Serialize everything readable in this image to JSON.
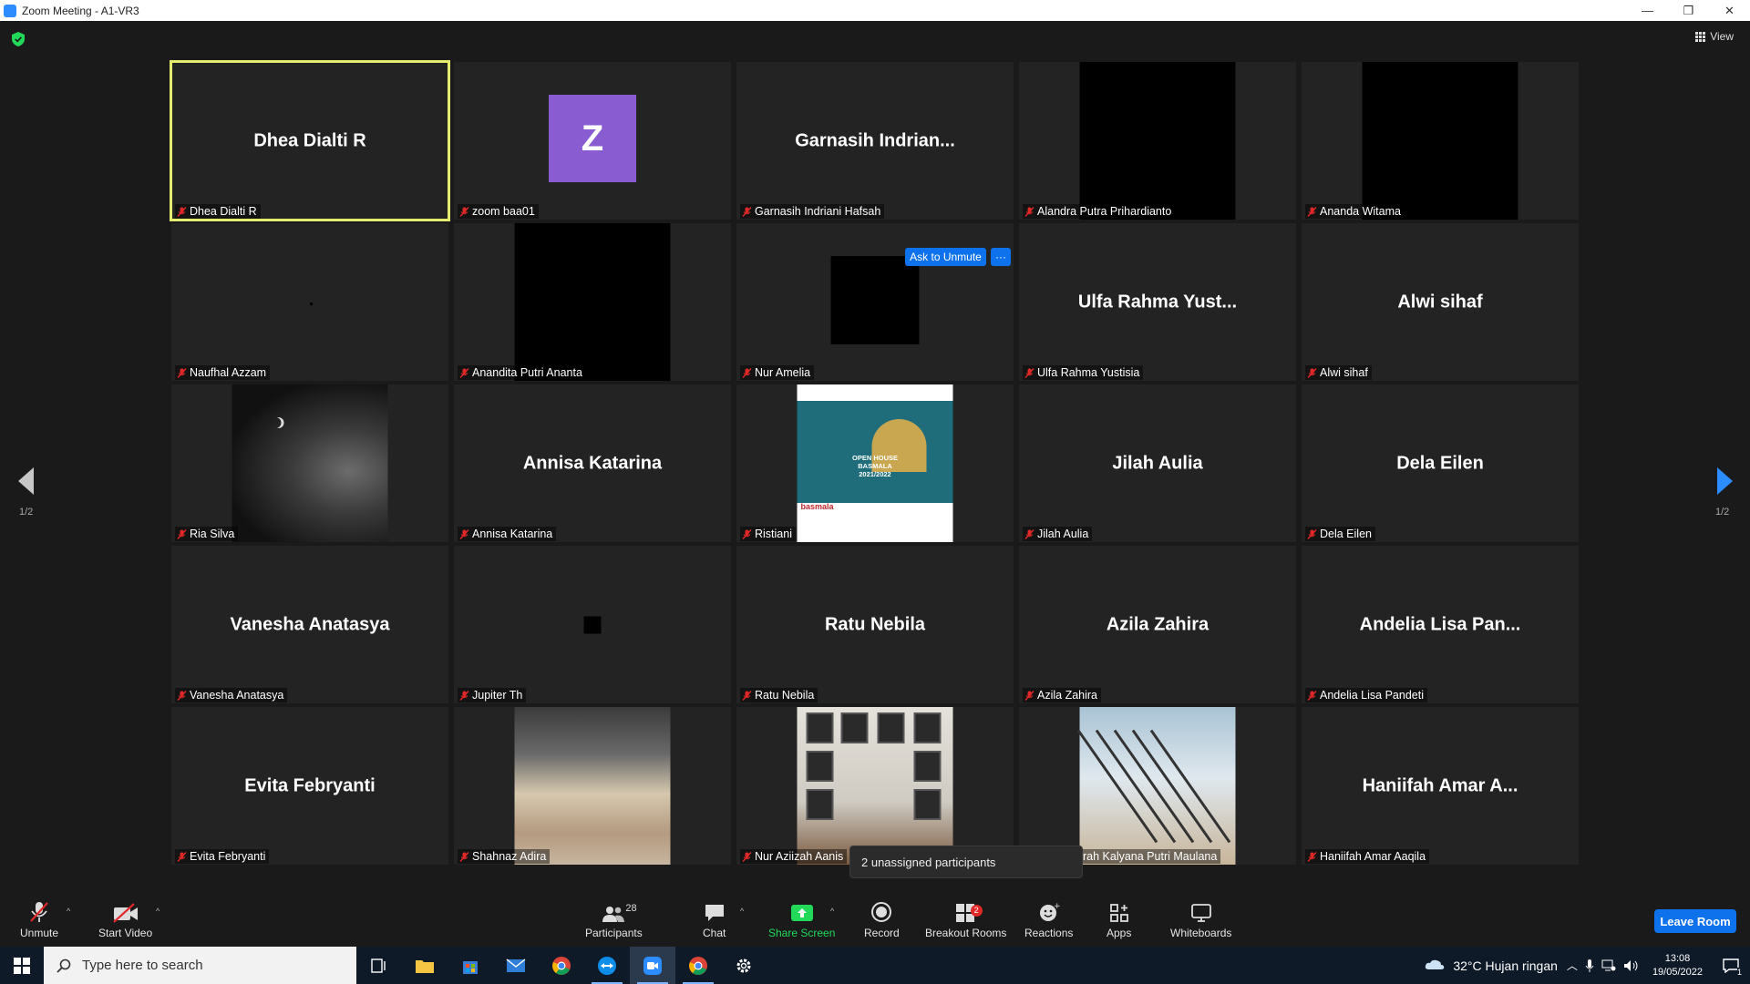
{
  "window": {
    "title": "Zoom Meeting - A1-VR3",
    "minimize_glyph": "—",
    "restore_glyph": "❐",
    "close_glyph": "✕"
  },
  "top": {
    "view_label": "View"
  },
  "tiles": [
    {
      "big": "Dhea Dialti R",
      "label": "Dhea Dialti R",
      "active": true
    },
    {
      "big": "",
      "label": "zoom baa01",
      "avatar_letter": "Z"
    },
    {
      "big": "Garnasih  Indrian...",
      "label": "Garnasih Indriani Hafsah"
    },
    {
      "big": "",
      "label": "Alandra Putra Prihardianto"
    },
    {
      "big": "",
      "label": "Ananda Witama"
    },
    {
      "big": "",
      "label": "Naufhal Azzam"
    },
    {
      "big": "",
      "label": "Anandita Putri Ananta"
    },
    {
      "big": "",
      "label": "Nur Amelia"
    },
    {
      "big": "Ulfa Rahma Yust...",
      "label": "Ulfa Rahma Yustisia"
    },
    {
      "big": "Alwi sihaf",
      "label": "Alwi sihaf"
    },
    {
      "big": "",
      "label": "Ria Silva"
    },
    {
      "big": "Annisa Katarina",
      "label": "Annisa Katarina"
    },
    {
      "big": "",
      "label": "Ristiani",
      "poster_text": "OPEN HOUSE\nBASMALA\n2021/2022",
      "poster_logo": "basmala"
    },
    {
      "big": "Jilah Aulia",
      "label": "Jilah Aulia"
    },
    {
      "big": "Dela Eilen",
      "label": "Dela Eilen"
    },
    {
      "big": "Vanesha Anatasya",
      "label": "Vanesha Anatasya"
    },
    {
      "big": "",
      "label": "Jupiter Th"
    },
    {
      "big": "Ratu Nebila",
      "label": "Ratu Nebila"
    },
    {
      "big": "Azila Zahira",
      "label": "Azila Zahira"
    },
    {
      "big": "Andelia Lisa Pan...",
      "label": "Andelia Lisa Pandeti"
    },
    {
      "big": "Evita Febryanti",
      "label": "Evita Febryanti"
    },
    {
      "big": "",
      "label": "Shahnaz Adira"
    },
    {
      "big": "",
      "label": "Nur Aziizah Aanis"
    },
    {
      "big": "",
      "label": "rah Kalyana Putri Maulana"
    },
    {
      "big": "Haniifah Amar A...",
      "label": "Haniifah Amar Aaqila"
    }
  ],
  "ask_to_unmute": "Ask to Unmute",
  "more_glyph": "···",
  "pager": {
    "left": "1/2",
    "right": "1/2"
  },
  "tooltip": "2 unassigned participants",
  "toolbar": {
    "unmute": "Unmute",
    "start_video": "Start Video",
    "participants": "Participants",
    "participants_count": "28",
    "chat": "Chat",
    "share_screen": "Share Screen",
    "record": "Record",
    "breakout_rooms": "Breakout Rooms",
    "breakout_badge": "2",
    "reactions": "Reactions",
    "apps": "Apps",
    "whiteboards": "Whiteboards",
    "leave": "Leave Room"
  },
  "taskbar": {
    "search_placeholder": "Type here to search",
    "weather": "32°C  Hujan ringan",
    "time": "13:08",
    "date": "19/05/2022",
    "notification_count": "1"
  },
  "colors": {
    "accent_blue": "#0e72ed",
    "active_speaker": "#e4ed6d",
    "share_green": "#23d959",
    "muted_red": "#e02828"
  }
}
